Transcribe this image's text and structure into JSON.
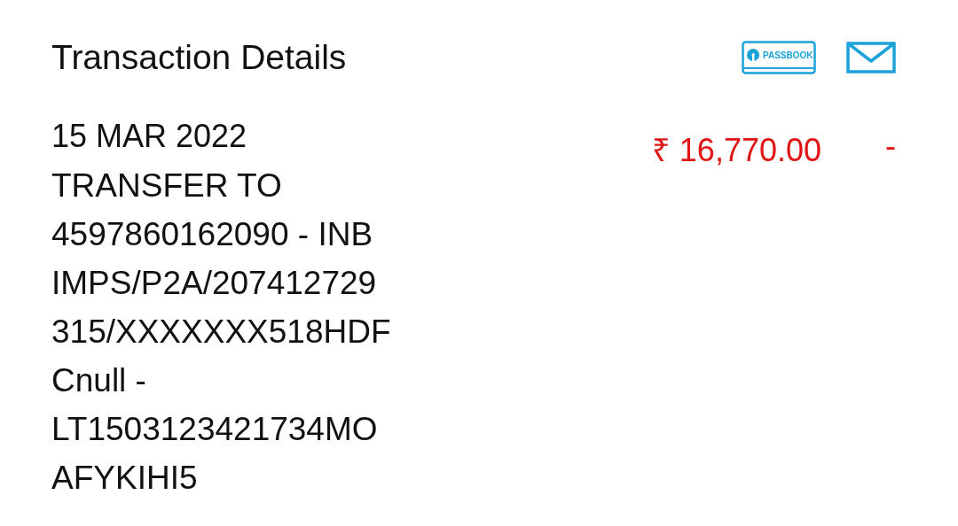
{
  "header": {
    "title": "Transaction Details",
    "passbook_icon_label": "PASSBOOK"
  },
  "transaction": {
    "date": "15 MAR 2022",
    "description_lines": [
      "TRANSFER TO",
      "4597860162090 - INB",
      "IMPS/P2A/207412729",
      "315/XXXXXXX518HDF",
      "Cnull -",
      "LT1503123421734MO",
      "AFYKIHI5"
    ],
    "amount": "₹ 16,770.00",
    "debit": true,
    "balance": "-"
  }
}
